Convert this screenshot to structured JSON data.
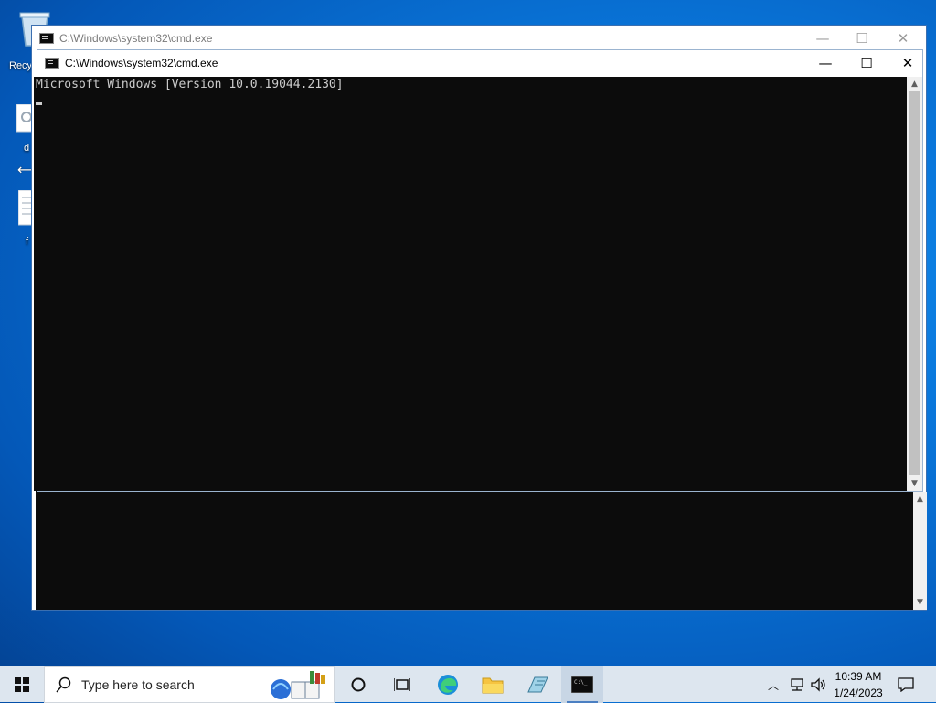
{
  "desktop": {
    "icons": [
      {
        "label": "Recy"
      },
      {
        "label": "d"
      },
      {
        "label": "f"
      }
    ]
  },
  "back_window": {
    "title": "C:\\Windows\\system32\\cmd.exe"
  },
  "front_window": {
    "title": "C:\\Windows\\system32\\cmd.exe",
    "console_text": "Microsoft Windows [Version 10.0.19044.2130]"
  },
  "window_controls": {
    "minimize": "—",
    "maximize": "☐",
    "close": "✕"
  },
  "taskbar": {
    "search_placeholder": "Type here to search",
    "clock_time": "10:39 AM",
    "clock_date": "1/24/2023"
  },
  "colors": {
    "console_bg": "#0c0c0c",
    "console_fg": "#cccccc",
    "taskbar_bg": "#dde6ef"
  }
}
